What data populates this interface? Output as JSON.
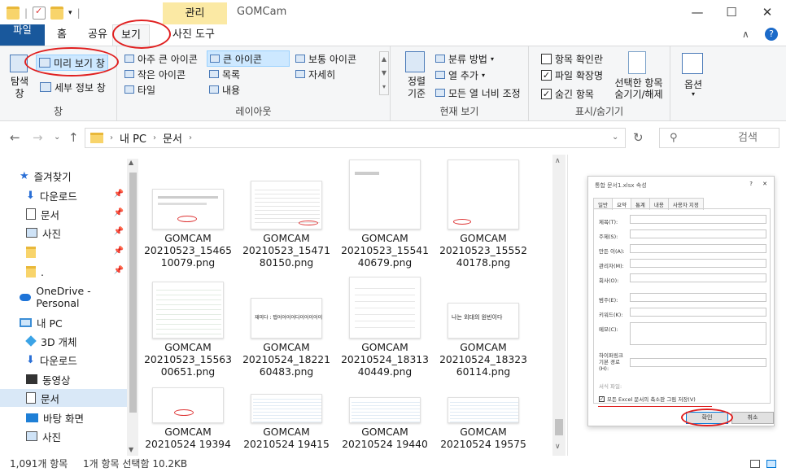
{
  "window": {
    "title": "GOMCam",
    "context_tab": "관리",
    "minimize": "—",
    "maximize": "☐",
    "close": "✕"
  },
  "tabs": [
    {
      "label": "파일"
    },
    {
      "label": "홈"
    },
    {
      "label": "공유"
    },
    {
      "label": "보기"
    },
    {
      "label": "사진 도구"
    }
  ],
  "ribbon": {
    "panes": {
      "nav_pane": "탐색\n창",
      "preview_pane": "미리 보기 창",
      "details_pane": "세부 정보 창",
      "group_title": "창"
    },
    "layout": {
      "items": [
        "아주 큰 아이콘",
        "큰 아이콘",
        "보통 아이콘",
        "작은 아이콘",
        "목록",
        "자세히",
        "타일",
        "내용"
      ],
      "selected": "큰 아이콘",
      "group_title": "레이아웃"
    },
    "current_view": {
      "sort": "정렬\n기준",
      "group_by": "분류 방법",
      "add_column": "열 추가",
      "fit_columns": "모든 열 너비 조정",
      "group_title": "현재 보기"
    },
    "show_hide": {
      "item_checkbox": {
        "label": "항목 확인란",
        "checked": false
      },
      "file_ext": {
        "label": "파일 확장명",
        "checked": true
      },
      "hidden_items": {
        "label": "숨긴 항목",
        "checked": true
      },
      "hide_selected": "선택한 항목\n숨기기/해제",
      "group_title": "표시/숨기기"
    },
    "options": "옵션"
  },
  "address": {
    "path": [
      "내 PC",
      "문서"
    ],
    "search_placeholder": "검색"
  },
  "sidebar": {
    "items": [
      {
        "label": "즐겨찾기",
        "icon": "star-icon"
      },
      {
        "label": "다운로드",
        "icon": "download-icon"
      },
      {
        "label": "문서",
        "icon": "document-icon"
      },
      {
        "label": "사진",
        "icon": "picture-icon"
      },
      {
        "label": "",
        "icon": "folder-icon"
      },
      {
        "label": ".",
        "icon": "folder-icon"
      },
      {
        "label": "OneDrive - Personal",
        "icon": "cloud-icon"
      },
      {
        "label": "내 PC",
        "icon": "pc-icon"
      },
      {
        "label": "3D 개체",
        "icon": "cube-icon"
      },
      {
        "label": "다운로드",
        "icon": "download-icon"
      },
      {
        "label": "동영상",
        "icon": "video-icon"
      },
      {
        "label": "문서",
        "icon": "document-icon"
      },
      {
        "label": "바탕 화면",
        "icon": "desktop-icon"
      },
      {
        "label": "사진",
        "icon": "picture-icon"
      }
    ]
  },
  "files": [
    {
      "line1": "GOMCAM",
      "line2": "20210523_15465",
      "line3": "10079.png"
    },
    {
      "line1": "GOMCAM",
      "line2": "20210523_15471",
      "line3": "80150.png"
    },
    {
      "line1": "GOMCAM",
      "line2": "20210523_15541",
      "line3": "40679.png"
    },
    {
      "line1": "GOMCAM",
      "line2": "20210523_15552",
      "line3": "40178.png"
    },
    {
      "line1": "GOMCAM",
      "line2": "20210523_15563",
      "line3": "00651.png"
    },
    {
      "line1": "GOMCAM",
      "line2": "20210524_18221",
      "line3": "60483.png"
    },
    {
      "line1": "GOMCAM",
      "line2": "20210524_18313",
      "line3": "40449.png"
    },
    {
      "line1": "GOMCAM",
      "line2": "20210524_18323",
      "line3": "60114.png"
    },
    {
      "line1": "GOMCAM",
      "line2": "20210524 19394",
      "line3": ""
    },
    {
      "line1": "GOMCAM",
      "line2": "20210524 19415",
      "line3": ""
    },
    {
      "line1": "GOMCAM",
      "line2": "20210524 19440",
      "line3": ""
    },
    {
      "line1": "GOMCAM",
      "line2": "20210524 19575",
      "line3": ""
    }
  ],
  "thumb_texts": {
    "t6": "재미다 : 탭어어어어다이어이어이",
    "t8": "나는 외대의 원빈이다"
  },
  "preview": {
    "title": "통합 문서1.xlsx 속성",
    "tabs": [
      "일반",
      "요약",
      "통계",
      "내용",
      "사용자 지정"
    ],
    "fields": [
      "제목(T):",
      "주제(S):",
      "만든 이(A):",
      "관리자(M):",
      "회사(O):",
      "범주(E):",
      "키워드(K):",
      "메모(C):",
      "하이퍼링크\n기본 경로\n(H):",
      "서식 파일:"
    ],
    "checkbox": "모든 Excel 문서의 축소판 그림 저장(V)",
    "ok": "확인",
    "cancel": "취소"
  },
  "status": {
    "count": "1,091개 항목",
    "selected": "1개 항목 선택함 10.2KB"
  }
}
